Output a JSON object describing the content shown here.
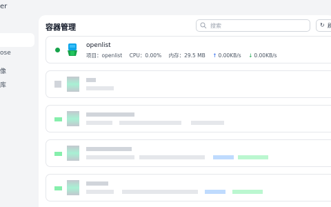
{
  "sidebar": {
    "app_title_fragment": "er",
    "items": [
      {
        "label": ""
      },
      {
        "label": "ose"
      },
      {
        "label": "像"
      },
      {
        "label": "库"
      }
    ]
  },
  "header": {
    "title": "容器管理",
    "search_placeholder": "搜索",
    "refresh_label": "刷"
  },
  "containers": [
    {
      "name": "openlist",
      "status": "running",
      "project_label": "项目：",
      "project": "openlist",
      "cpu_label": "CPU：",
      "cpu": "0.00%",
      "mem_label": "内存：",
      "mem": "29.5 MB",
      "up_arrow": "↑",
      "up_rate": "0.00KB/s",
      "down_arrow": "↓",
      "down_rate": "0.00KB/s"
    }
  ],
  "colors": {
    "status_running": "#16a34a",
    "accent_blue": "#2563eb"
  }
}
